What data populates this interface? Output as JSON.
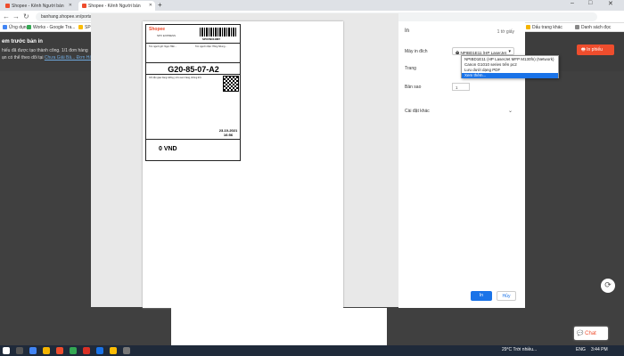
{
  "browser": {
    "tabs": [
      {
        "label": "Shopee - Kênh Người bán"
      },
      {
        "label": "Shopee - Kênh Người bán"
      }
    ],
    "url": "banhang.shopee.vn/portal/sale/mass/document?task_id=VN_265141562_dce39643c59e752ac9b96e7e9040753f_g&shop_id=265141562",
    "bookmarks": [
      "Ứng dụng",
      "Works - Google Tra...",
      "SP",
      "Dấu trang khác",
      "Danh sách đọc"
    ]
  },
  "page": {
    "title": "em trước bản in",
    "line1": "hiếu đã được tạo thành công. 1/1 đơn hàng",
    "line2_prefix": "ạn có thể theo dõi tại",
    "line2_link": "Chưa Giải Bả... Đơn Hà...",
    "print_button": "In phiếu"
  },
  "label": {
    "logo": "Shopee",
    "spx": "SPX EXPRESS",
    "tracking": "SPXVN011887",
    "route": "G20-85-07-A2",
    "date": "23-10-2021",
    "time": "16:56",
    "cod": "0 VND",
    "sender": "Tên người gửi: Ngọc Hiền...",
    "receiver": "Tên người nhận: Hồng Nhung...",
    "note": "Chỉ dẫn giao hàng: Đồng ý cho xem hàng, không thử."
  },
  "print_dialog": {
    "title": "In",
    "sheets": "1 tờ giấy",
    "printer_label": "Máy in đích",
    "printer_value": "NPIBD1E11 (HP LaserJet",
    "pages_label": "Trang",
    "color_label": "Bản sao",
    "color_value": "1",
    "more_settings": "Cài đặt khác",
    "dropdown": [
      "NPIBD1E11 (HP LaserJet MFP M130fn) (Network)",
      "Canon G1010 series trên pc2",
      "Lưu dưới dạng PDF",
      "Xem thêm..."
    ],
    "dropdown_selected_index": 3,
    "ok_button": "In",
    "cancel_button": "Hủy"
  },
  "chat": {
    "label": "Chat"
  },
  "taskbar": {
    "weather": "29°C Trời nhiều...",
    "lang": "ENG",
    "time": "3:44 PM"
  }
}
